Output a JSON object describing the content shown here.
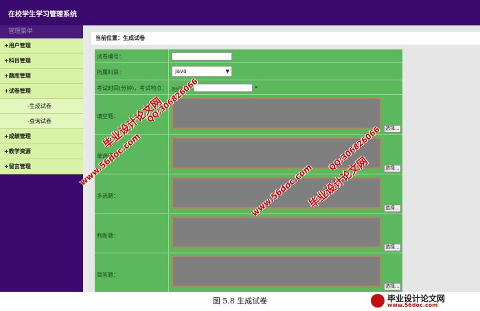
{
  "app": {
    "title": "在校学生学习管理系统"
  },
  "sidebar": {
    "header": "管理菜单",
    "items": [
      {
        "label": "+用户管理",
        "sub": false
      },
      {
        "label": "+科目管理",
        "sub": false
      },
      {
        "label": "+题库管理",
        "sub": false
      },
      {
        "label": "+试卷管理",
        "sub": false
      },
      {
        "label": "-生成试卷",
        "sub": true
      },
      {
        "label": "-查询试卷",
        "sub": true
      },
      {
        "label": "+成绩管理",
        "sub": false
      },
      {
        "label": "+教学资源",
        "sub": false
      },
      {
        "label": "+留言管理",
        "sub": false
      }
    ]
  },
  "breadcrumb": "当前位置：生成试卷",
  "form": {
    "paper_id_label": "试卷编号：",
    "paper_id_value": "",
    "subject_label": "所属科目：",
    "subject_value": "java",
    "exam_label": "考试时间(分钟)，考试地点：",
    "time_label": "时间：",
    "time_value": "",
    "required_mark": "*",
    "fill_label": "填空题：",
    "single_label": "单选题：",
    "multi_label": "多选题：",
    "judge_label": "判断题：",
    "short_label": "简答题：",
    "choose_button": "选择..."
  },
  "caption": "图 5.8  生成试卷",
  "watermarks": {
    "site_cn": "毕业设计论文网",
    "qq": "QQ:306826066",
    "url": "www.56doc.com"
  },
  "colors": {
    "topbar": "#3b0a6e",
    "sidebar_item": "#d9f3a6",
    "form_bg": "#5cb85c",
    "textarea": "#7f7f7f",
    "watermark": "#d40000"
  }
}
